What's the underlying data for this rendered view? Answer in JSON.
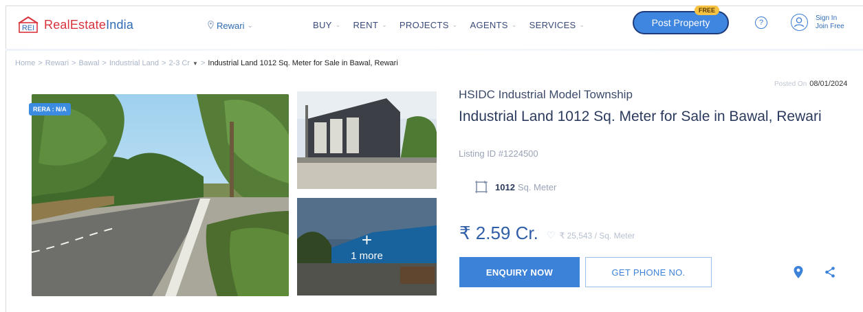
{
  "header": {
    "logo_mark": "REI",
    "logo_text_primary": "RealEstate",
    "logo_text_secondary": "India",
    "location": "Rewari",
    "nav": [
      {
        "label": "BUY"
      },
      {
        "label": "RENT"
      },
      {
        "label": "PROJECTS"
      },
      {
        "label": "AGENTS"
      },
      {
        "label": "SERVICES"
      }
    ],
    "post_property_label": "Post Property",
    "free_badge": "FREE",
    "help_icon": "?",
    "sign_in": "Sign In",
    "join_free": "Join Free"
  },
  "breadcrumb": {
    "items": [
      "Home",
      "Rewari",
      "Bawal",
      "Industrial Land",
      "2-3 Cr"
    ],
    "separator": ">",
    "current": "Industrial Land 1012 Sq. Meter for Sale in Bawal, Rewari"
  },
  "gallery": {
    "rera_badge": "RERA : N/A",
    "more_plus": "+",
    "more_label": "1 more"
  },
  "listing": {
    "posted_label": "Posted On",
    "posted_date": "08/01/2024",
    "project_name": "HSIDC Industrial Model Township",
    "title": "Industrial Land 1012 Sq. Meter for Sale in Bawal, Rewari",
    "listing_id": "Listing ID #1224500",
    "area_value": "1012",
    "area_unit": "Sq. Meter",
    "price": "₹ 2.59 Cr.",
    "rate": "₹ 25,543 / Sq. Meter",
    "enquiry_label": "ENQUIRY NOW",
    "phone_label": "GET PHONE NO."
  },
  "colors": {
    "brand_red": "#d8323c",
    "brand_blue": "#2f6bb3",
    "button_blue": "#3c82d8"
  },
  "icons": [
    "location-pin-icon",
    "chevron-down-icon",
    "help-icon",
    "user-icon",
    "area-icon",
    "heart-icon",
    "map-pin-icon",
    "share-icon"
  ]
}
